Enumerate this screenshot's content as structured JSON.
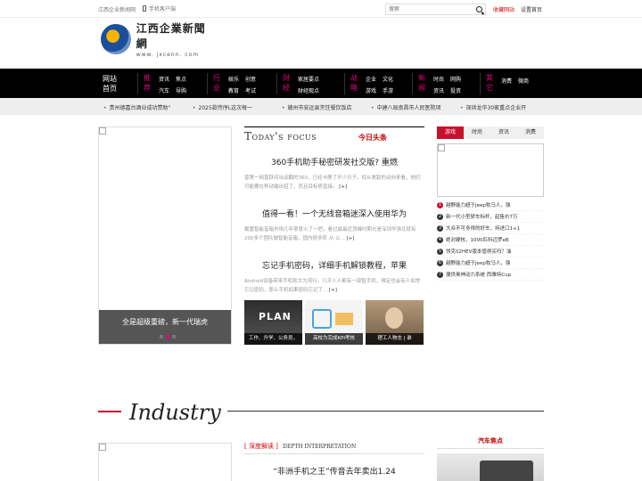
{
  "topbar": {
    "site_name": "江西企业新闻网",
    "mobile_client": "手机客户端",
    "search_placeholder": "搜索",
    "favorite": "收藏网站",
    "set_home": "设置首页"
  },
  "logo": {
    "name": "江西企業新聞網",
    "url": "www. jxcenn. com"
  },
  "nav": {
    "home": "网站首页",
    "groups": [
      {
        "cat": "推荐",
        "links": [
          "资讯",
          "焦点",
          "汽车",
          "导购"
        ]
      },
      {
        "cat": "行业",
        "links": [
          "娱乐",
          "创意",
          "教育",
          "考试"
        ]
      },
      {
        "cat": "财经",
        "links": [
          "家居要点",
          "",
          "财经观点",
          ""
        ]
      },
      {
        "cat": "战略",
        "links": [
          "企业",
          "文化",
          "游戏",
          "手游"
        ]
      },
      {
        "cat": "新闻",
        "links": [
          "时尚",
          "网购",
          "资讯",
          "投资"
        ]
      },
      {
        "cat": "其它",
        "links": [
          "消费",
          "微商",
          "",
          ""
        ]
      }
    ]
  },
  "ticker": [
    "贵州德嘉台酒业成功赞助“",
    "2025款传序L这次每一",
    "赣州市安远县烹饪餐饮饭店",
    "中建八局南昌市人民医院项",
    "深圳龙华30家重点企业开"
  ],
  "slider": {
    "caption": "全是超级重磅，新一代瑞虎"
  },
  "focus": {
    "title_en": "Today's focus",
    "title_cn": "今日头条"
  },
  "stories": [
    {
      "title": "360手机助手秘密研发社交版? 重燃",
      "summary": "曾第一网曾跃间出动翻的360，已经卡静了不少日子。倪从裹蹈的动向来看，他们可能要在移动端出招了，而且目标很直接。",
      "more": "[+]"
    },
    {
      "title": "值得一看！一个无线音箱迷深入使用华为",
      "summary": "截置智能音箱市场几年很意火了一把，看过最最近顶峰时期光是深圳华强北就有200多个团队做智能音箱，国内很多阶 从 公...",
      "more": "[+]"
    },
    {
      "title": "忘记手机密码，详细手机解锁教程，苹果",
      "summary": "Android设备带来手机和大为流行，几乎人人都有一部智手机，难定也会有人如常忘记密码，那么手机如果密码忘记了...",
      "more": "[+]"
    }
  ],
  "thumbs": [
    {
      "caption": "工作、升学、公务员，",
      "art_text": "PLAN"
    },
    {
      "caption": "高校为完成KPI考核"
    },
    {
      "caption": "理工人物志 | 谁"
    }
  ],
  "sidebar": {
    "tabs": [
      "游戏",
      "时尚",
      "资讯",
      "消费"
    ],
    "ranking": [
      "越野能力超于Jeep牧马人，强",
      "新一代小型轿车标杆，起售价7万",
      "大众不可多得的好车，持进口1+1",
      "绝对硬核，1000匹科迈罗eB",
      "领克02HEV版本值得买吗？油",
      "越野能力超于Jeep牧马人，强",
      "捷供奥神动力系统 西雅特Cup"
    ]
  },
  "industry": {
    "title": "Industry",
    "deep_cn": "[ 深度解读 ]",
    "deep_en": "DEPTH INTERPRETATION",
    "deep_story": "“非洲手机之王”传音去年卖出1.24",
    "auto_focus": "汽车焦点"
  },
  "colors": {
    "accent": "#c8102e",
    "nav_category": "#e3007f",
    "nav_bg": "#000000"
  }
}
